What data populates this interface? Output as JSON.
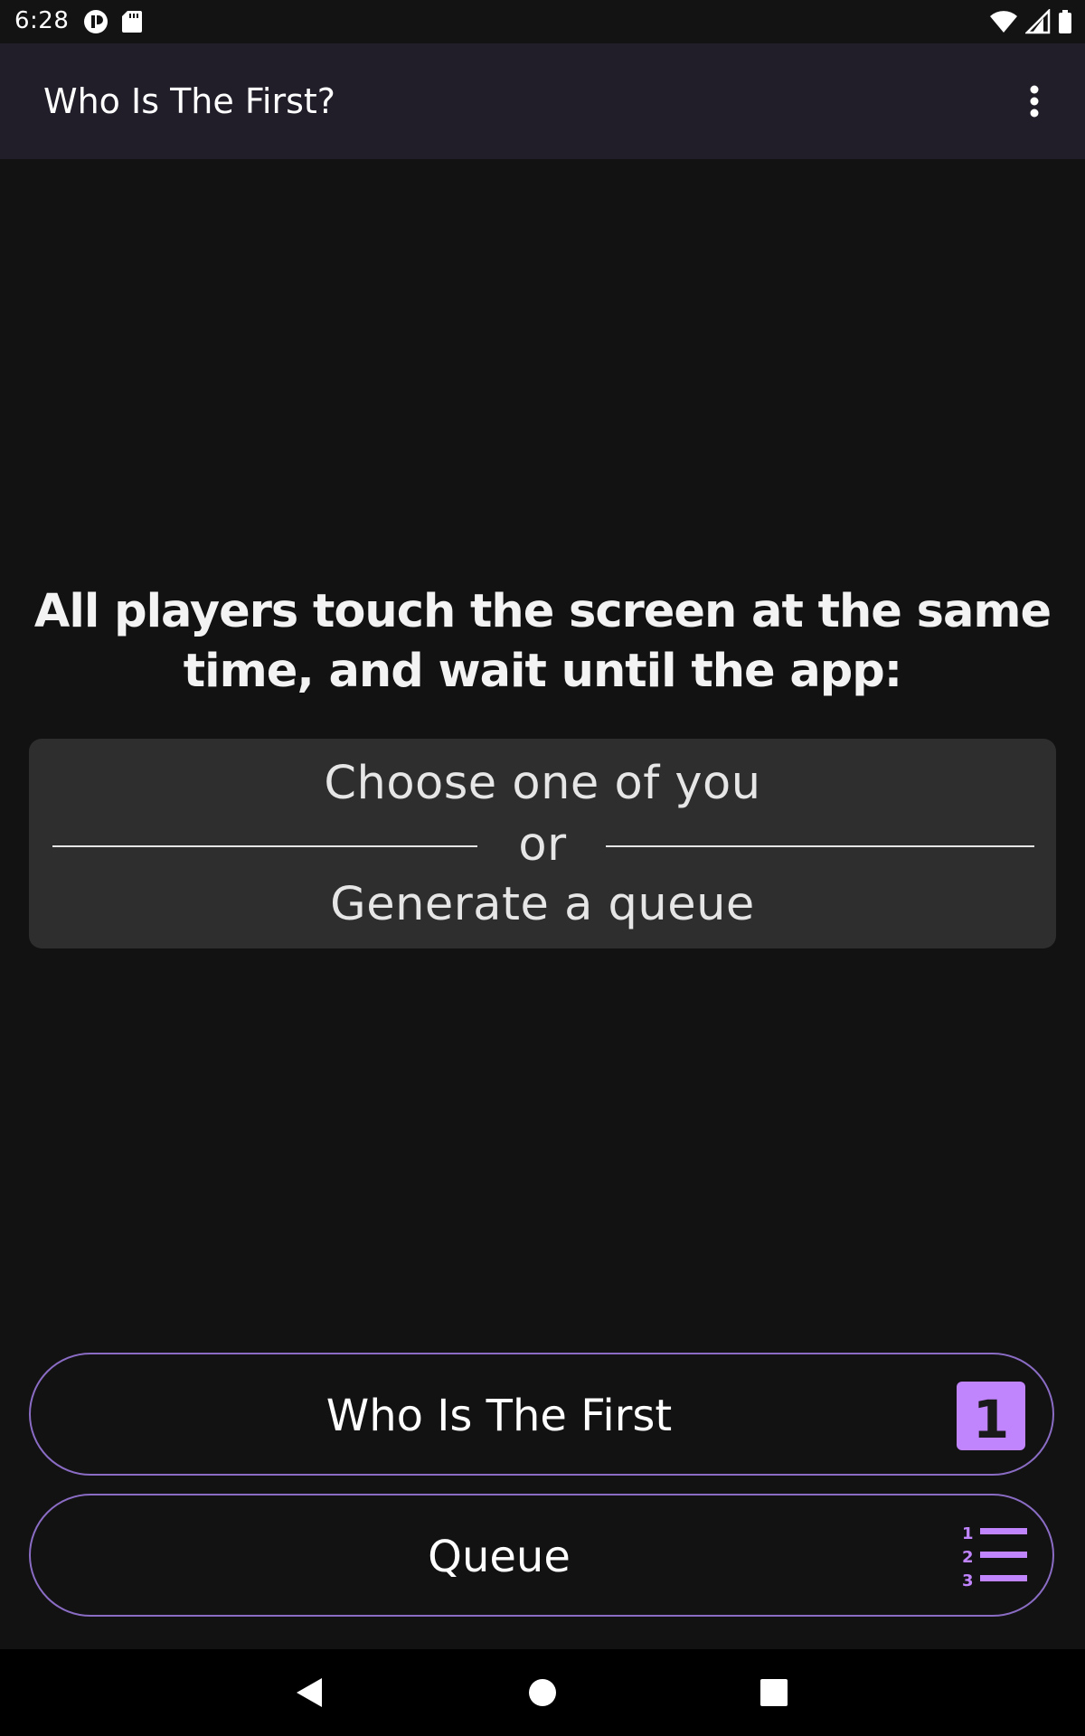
{
  "status_bar": {
    "time": "6:28",
    "left_icons": [
      "circle-app-icon",
      "sd-card-icon"
    ],
    "right_icons": [
      "wifi-icon",
      "cellular-signal-icon",
      "battery-icon"
    ]
  },
  "app_bar": {
    "title": "Who Is The First?",
    "menu_icon": "more-vert-icon"
  },
  "main": {
    "instruction": "All players touch the screen at the same time, and wait until the app:",
    "options": {
      "choose": "Choose one of you",
      "separator": "or",
      "queue": "Generate a queue"
    }
  },
  "buttons": {
    "first": {
      "label": "Who Is The First",
      "icon": "looks-one-icon",
      "icon_digit": "1"
    },
    "queue": {
      "label": "Queue",
      "icon": "format-list-numbered-icon",
      "icon_digits": [
        "1",
        "2",
        "3"
      ]
    }
  },
  "nav_bar": {
    "back_icon": "back-triangle-icon",
    "home_icon": "home-circle-icon",
    "recents_icon": "recents-square-icon"
  },
  "colors": {
    "background": "#121212",
    "app_bar": "#211d29",
    "card": "#2e2e2e",
    "accent": "#c084fc",
    "button_border": "#8a6cc4"
  }
}
